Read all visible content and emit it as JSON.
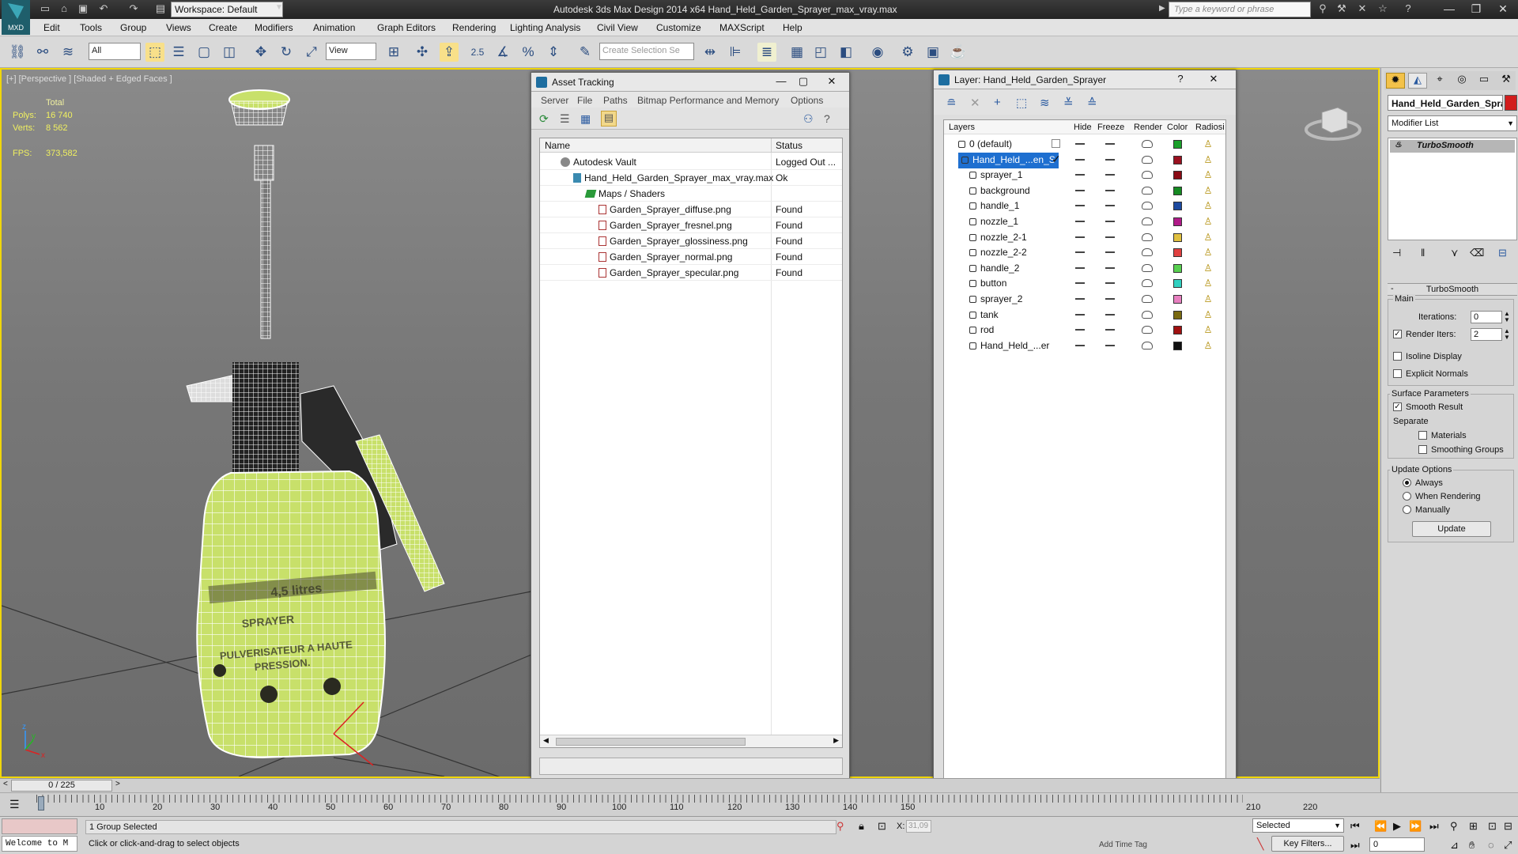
{
  "app": {
    "title": "Autodesk 3ds Max Design 2014 x64      Hand_Held_Garden_Sprayer_max_vray.max",
    "logo_text": "MXD",
    "workspace": "Workspace: Default",
    "search_placeholder": "Type a keyword or phrase"
  },
  "menu": [
    "Edit",
    "Tools",
    "Group",
    "Views",
    "Create",
    "Modifiers",
    "Animation",
    "Graph Editors",
    "Rendering",
    "Lighting Analysis",
    "Civil View",
    "Customize",
    "MAXScript",
    "Help"
  ],
  "toolbar": {
    "filter": "All",
    "ref_coord": "View",
    "snap_value": "2.5",
    "selection_set_placeholder": "Create Selection Se"
  },
  "viewport": {
    "label": "[+] [Perspective ] [Shaded + Edged Faces ]",
    "stats": {
      "total_label": "Total",
      "polys_label": "Polys:",
      "polys_value": "16 740",
      "verts_label": "Verts:",
      "verts_value": "8 562",
      "fps_label": "FPS:",
      "fps_value": "373,582"
    },
    "label_text": {
      "line1": "4,5 litres",
      "line2": "SPRAYER",
      "line3": "PULVERISATEUR A HAUTE",
      "line4": "PRESSION."
    },
    "accent_color": "#c8e06a"
  },
  "asset_tracking": {
    "title": "Asset Tracking",
    "menu": [
      "Server",
      "File",
      "Paths",
      "Bitmap Performance and Memory",
      "Options"
    ],
    "columns": {
      "name": "Name",
      "status": "Status"
    },
    "rows": [
      {
        "name": "Autodesk Vault",
        "status": "Logged Out ...",
        "indent": 1,
        "icon": "vault-icon"
      },
      {
        "name": "Hand_Held_Garden_Sprayer_max_vray.max",
        "status": "Ok",
        "indent": 2,
        "icon": "max-file-icon"
      },
      {
        "name": "Maps / Shaders",
        "status": "",
        "indent": 3,
        "icon": "folder-icon"
      },
      {
        "name": "Garden_Sprayer_diffuse.png",
        "status": "Found",
        "indent": 4,
        "icon": "image-file-icon"
      },
      {
        "name": "Garden_Sprayer_fresnel.png",
        "status": "Found",
        "indent": 4,
        "icon": "image-file-icon"
      },
      {
        "name": "Garden_Sprayer_glossiness.png",
        "status": "Found",
        "indent": 4,
        "icon": "image-file-icon"
      },
      {
        "name": "Garden_Sprayer_normal.png",
        "status": "Found",
        "indent": 4,
        "icon": "image-file-icon"
      },
      {
        "name": "Garden_Sprayer_specular.png",
        "status": "Found",
        "indent": 4,
        "icon": "image-file-icon"
      }
    ]
  },
  "layer_window": {
    "title": "Layer: Hand_Held_Garden_Sprayer",
    "columns": [
      "Layers",
      "Hide",
      "Freeze",
      "Render",
      "Color",
      "Radiosi"
    ],
    "rows": [
      {
        "name": "0 (default)",
        "color": "#1aa02a",
        "selected": false,
        "level": 0,
        "extra": "checkbox"
      },
      {
        "name": "Hand_Held_...en_S",
        "color": "#9a1020",
        "selected": true,
        "level": 0,
        "extra": "check"
      },
      {
        "name": "sprayer_1",
        "color": "#8a0a14",
        "selected": false,
        "level": 1
      },
      {
        "name": "background",
        "color": "#158a22",
        "selected": false,
        "level": 1
      },
      {
        "name": "handle_1",
        "color": "#1c4aa0",
        "selected": false,
        "level": 1
      },
      {
        "name": "nozzle_1",
        "color": "#b01a88",
        "selected": false,
        "level": 1
      },
      {
        "name": "nozzle_2-1",
        "color": "#e0c040",
        "selected": false,
        "level": 1
      },
      {
        "name": "nozzle_2-2",
        "color": "#e04040",
        "selected": false,
        "level": 1
      },
      {
        "name": "handle_2",
        "color": "#58d050",
        "selected": false,
        "level": 1
      },
      {
        "name": "button",
        "color": "#30d0c0",
        "selected": false,
        "level": 1
      },
      {
        "name": "sprayer_2",
        "color": "#e880c0",
        "selected": false,
        "level": 1
      },
      {
        "name": "tank",
        "color": "#7a6a10",
        "selected": false,
        "level": 1
      },
      {
        "name": "rod",
        "color": "#a01010",
        "selected": false,
        "level": 1
      },
      {
        "name": "Hand_Held_...er",
        "color": "#101010",
        "selected": false,
        "level": 1
      }
    ],
    "check_mark": "✓"
  },
  "command_panel": {
    "object_name": "Hand_Held_Garden_Spra",
    "object_color": "#d21c1c",
    "modifier_list": "Modifier List",
    "modifier_stack": [
      "TurboSmooth"
    ],
    "turbosmooth": {
      "title": "TurboSmooth",
      "main": "Main",
      "iterations_label": "Iterations:",
      "iterations_value": "0",
      "render_iters_label": "Render Iters:",
      "render_iters_value": "2",
      "render_iters_checked": true,
      "isoline_label": "Isoline Display",
      "explicit_normals_label": "Explicit Normals",
      "surface_params": "Surface Parameters",
      "smooth_result_label": "Smooth Result",
      "separate_label": "Separate",
      "materials_label": "Materials",
      "smoothing_groups_label": "Smoothing Groups",
      "update_options": "Update Options",
      "always_label": "Always",
      "when_rendering_label": "When Rendering",
      "manually_label": "Manually",
      "update_button": "Update"
    }
  },
  "timeline": {
    "frame_display": "0 / 225",
    "ticks": [
      "10",
      "20",
      "30",
      "40",
      "50",
      "60",
      "70",
      "80",
      "90",
      "100",
      "110",
      "120",
      "130",
      "140",
      "150",
      "210",
      "220"
    ]
  },
  "status": {
    "selection": "1 Group Selected",
    "prompt": "Click or click-and-drag to select objects",
    "welcome": "Welcome to M",
    "x_label": "X:",
    "x_value": "31,09",
    "add_time_tag": "Add Time Tag",
    "key_mode": "Selected",
    "key_filters": "Key Filters...",
    "frame": "0"
  }
}
